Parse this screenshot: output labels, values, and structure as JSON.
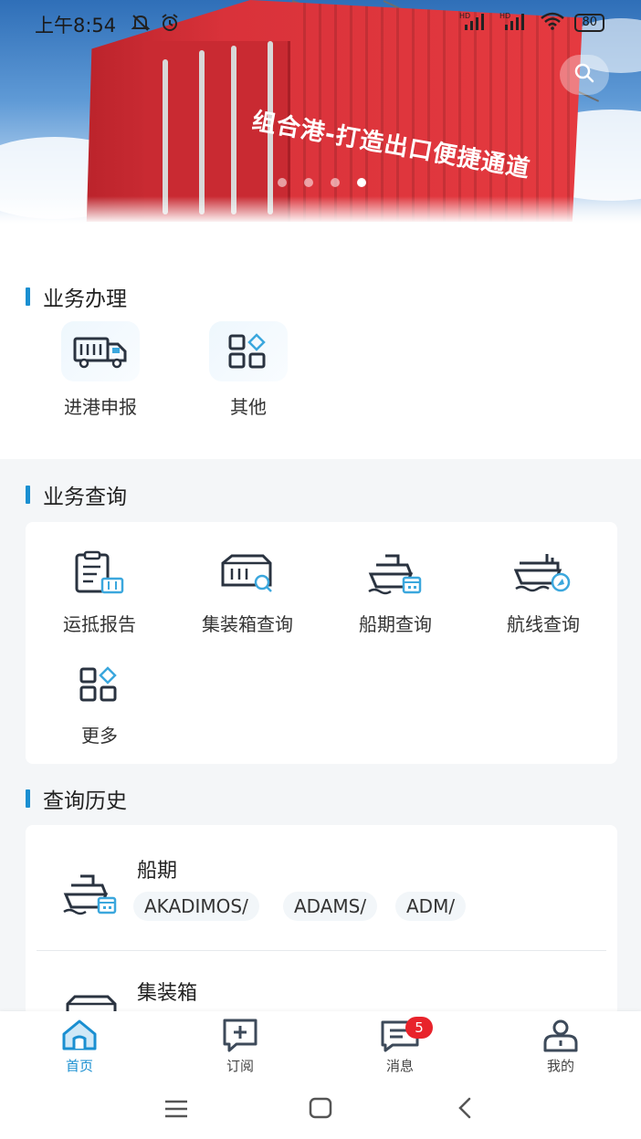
{
  "status_bar": {
    "time": "上午8:54",
    "network": "HD",
    "battery": "80"
  },
  "banner": {
    "slogan": "组合港-打造出口便捷通道",
    "slide_count": 4,
    "active_slide": 4
  },
  "business": {
    "title": "业务办理",
    "items": [
      {
        "label": "进港申报",
        "icon": "truck-icon"
      },
      {
        "label": "其他",
        "icon": "apps-icon"
      }
    ]
  },
  "query": {
    "title": "业务查询",
    "items": [
      {
        "label": "运抵报告",
        "icon": "clipboard-report-icon"
      },
      {
        "label": "集装箱查询",
        "icon": "container-search-icon"
      },
      {
        "label": "船期查询",
        "icon": "ship-schedule-icon"
      },
      {
        "label": "航线查询",
        "icon": "ship-route-icon"
      },
      {
        "label": "更多",
        "icon": "apps-icon"
      }
    ]
  },
  "history": {
    "title": "查询历史",
    "entries": [
      {
        "title": "船期",
        "icon": "ship-schedule-icon",
        "tags": [
          "AKADIMOS/",
          "ADAMS/",
          "ADM/"
        ]
      },
      {
        "title": "集装箱",
        "icon": "container-icon",
        "tags": []
      }
    ]
  },
  "tabbar": {
    "items": [
      {
        "label": "首页",
        "icon": "home-icon",
        "active": true
      },
      {
        "label": "订阅",
        "icon": "subscribe-icon",
        "active": false
      },
      {
        "label": "消息",
        "icon": "message-icon",
        "active": false,
        "badge": "5"
      },
      {
        "label": "我的",
        "icon": "profile-icon",
        "active": false
      }
    ]
  },
  "colors": {
    "accent": "#1a8fd1",
    "badge": "#e8232b",
    "container_red": "#d9323a"
  }
}
